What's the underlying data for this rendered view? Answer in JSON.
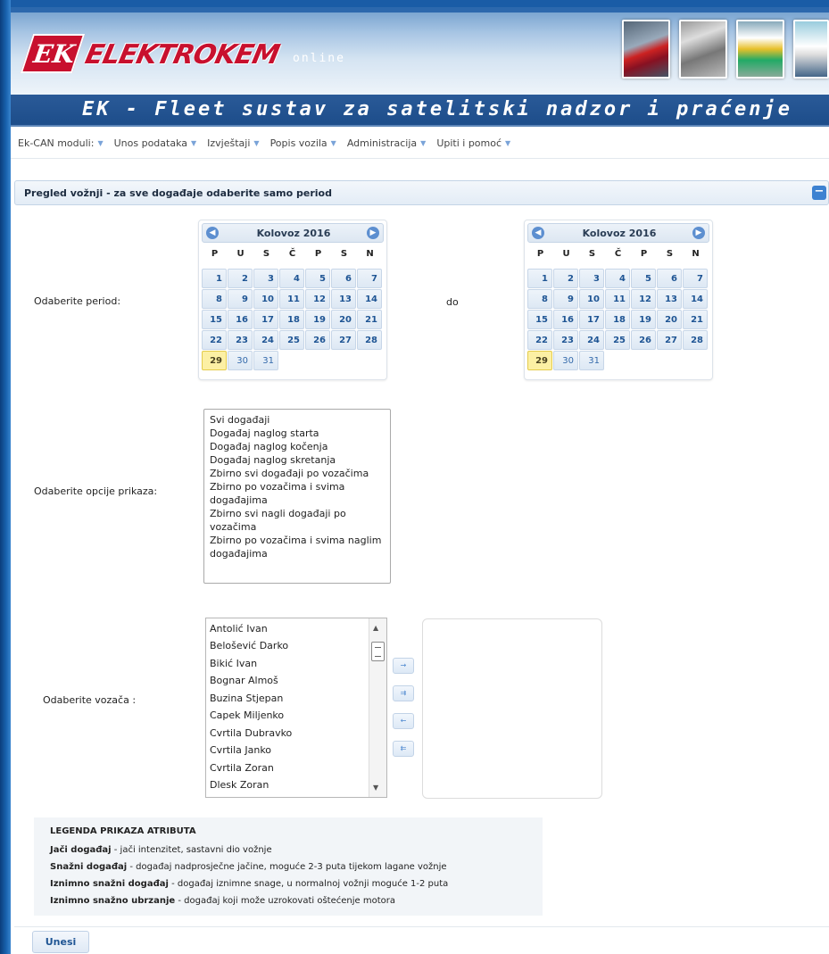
{
  "header": {
    "logo_mark": "EK",
    "logo_text": "ELEKTROKEM",
    "logo_sub": "online",
    "title": "EK - Fleet sustav za satelitski nadzor i praćenje"
  },
  "menu": [
    "Ek-CAN moduli:",
    "Unos podataka",
    "Izvještaji",
    "Popis vozila",
    "Administracija",
    "Upiti i pomoć"
  ],
  "section": {
    "title": "Pregled vožnji - za sve događaje odaberite samo period",
    "collapse_icon": "−"
  },
  "period": {
    "label": "Odaberite period:",
    "to_label": "do",
    "calendar_from": {
      "month": "Kolovoz 2016",
      "weekdays": [
        "P",
        "U",
        "S",
        "Č",
        "P",
        "S",
        "N"
      ],
      "days": [
        "1",
        "2",
        "3",
        "4",
        "5",
        "6",
        "7",
        "8",
        "9",
        "10",
        "11",
        "12",
        "13",
        "14",
        "15",
        "16",
        "17",
        "18",
        "19",
        "20",
        "21",
        "22",
        "23",
        "24",
        "25",
        "26",
        "27",
        "28",
        "29",
        "30",
        "31"
      ],
      "today": "29"
    },
    "calendar_to": {
      "month": "Kolovoz 2016",
      "weekdays": [
        "P",
        "U",
        "S",
        "Č",
        "P",
        "S",
        "N"
      ],
      "days": [
        "1",
        "2",
        "3",
        "4",
        "5",
        "6",
        "7",
        "8",
        "9",
        "10",
        "11",
        "12",
        "13",
        "14",
        "15",
        "16",
        "17",
        "18",
        "19",
        "20",
        "21",
        "22",
        "23",
        "24",
        "25",
        "26",
        "27",
        "28",
        "29",
        "30",
        "31"
      ],
      "today": "29"
    }
  },
  "options": {
    "label": "Odaberite opcije prikaza:",
    "items": [
      "Svi događaji",
      "Događaj naglog starta",
      "Događaj naglog kočenja",
      "Događaj naglog skretanja",
      "Zbirno svi događaji po vozačima",
      "Zbirno po vozačima i svima događajima",
      "Zbirno svi nagli događaji po vozačima",
      "Zbirno po vozačima i svima naglim događajima"
    ]
  },
  "drivers": {
    "label": "Odaberite vozača :",
    "items": [
      "Antolić Ivan",
      "Belošević Darko",
      "Bikić Ivan",
      "Bognar Almoš",
      "Buzina Stjepan",
      "Capek Miljenko",
      "Cvrtila Dubravko",
      "Cvrtila Janko",
      "Cvrtila Zoran",
      "Dlesk Zoran"
    ],
    "buttons": [
      "→",
      "⇉",
      "←",
      "⇇"
    ]
  },
  "legend": {
    "title": "LEGENDA PRIKAZA ATRIBUTA",
    "rows": [
      {
        "term": "Jači događaj",
        "desc": " - jači intenzitet, sastavni dio vožnje"
      },
      {
        "term": "Snažni događaj",
        "desc": " - događaj nadprosječne jačine, moguće 2-3 puta tijekom lagane vožnje"
      },
      {
        "term": "Iznimno snažni događaj",
        "desc": " - događaj iznimne snage, u normalnoj vožnji moguće 1-2 puta"
      },
      {
        "term": "Iznimno snažno ubrzanje",
        "desc": " - događaj koji može uzrokovati oštećenje motora"
      }
    ]
  },
  "submit_label": "Unesi"
}
